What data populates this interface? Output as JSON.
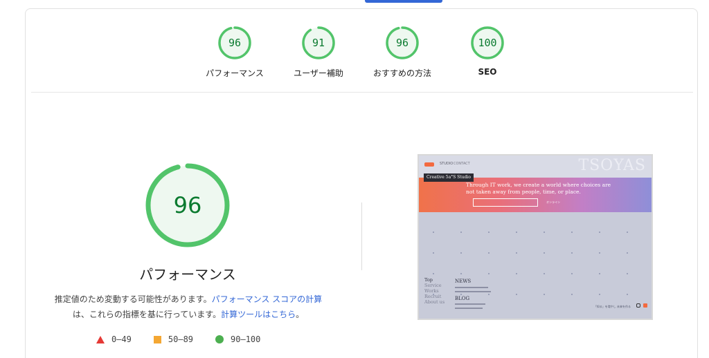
{
  "summary": {
    "items": [
      {
        "score": 96,
        "label": "パフォーマンス"
      },
      {
        "score": 91,
        "label": "ユーザー補助"
      },
      {
        "score": 96,
        "label": "おすすめの方法"
      },
      {
        "score": 100,
        "label": "SEO"
      }
    ]
  },
  "detail": {
    "score": 96,
    "title": "パフォーマンス",
    "desc_part1": "推定値のため変動する可能性があります。",
    "desc_link1": "パフォーマンス スコアの計算",
    "desc_part2": "は、これらの指標を基に行っています。",
    "desc_link2": "計算ツールはこちら",
    "desc_end": "。"
  },
  "legend": {
    "fail": "0–49",
    "average": "50–89",
    "pass": "90–100"
  },
  "colors": {
    "pass_stroke": "#0cce6b",
    "pass_text": "#0a7a2f",
    "pass_fill": "#e8f7ec",
    "link": "#3367d6",
    "tab_indicator": "#3367d6"
  },
  "screenshot": {
    "ghost_text": "TSOYAS",
    "nav1": "STUDIO",
    "nav2": "CONTACT",
    "badge": "Creative 5a°S Studio",
    "hero_line1": "Through IT work, we create a world where choices are",
    "hero_line2": "not taken away from people, time, or place.",
    "hero_sub": "オンライン",
    "side_nav": [
      "Top",
      "Service",
      "Works",
      "Recruit",
      "About us"
    ],
    "news_heading": "NEWS",
    "blog_heading": "BLOG",
    "footer_text": "「知る」を増やし 未来を作る"
  }
}
